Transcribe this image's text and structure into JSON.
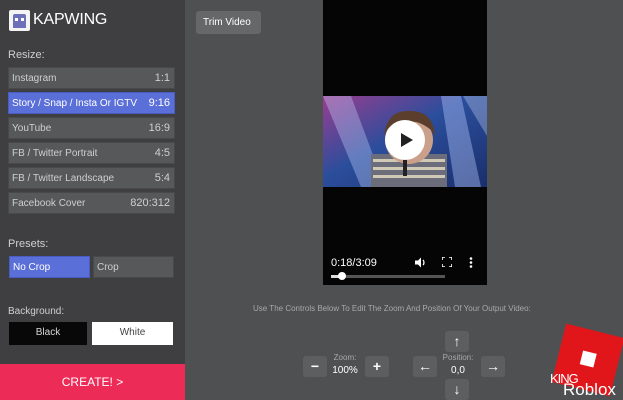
{
  "app": {
    "logo_text": "KAPWING"
  },
  "sidebar": {
    "resize_label": "Resize:",
    "sizes": [
      {
        "name": "Instagram",
        "ratio": "1:1"
      },
      {
        "name": "Story / Snap / Insta Or IGTV",
        "ratio": "9:16"
      },
      {
        "name": "YouTube",
        "ratio": "16:9"
      },
      {
        "name": "FB / Twitter Portrait",
        "ratio": "4:5"
      },
      {
        "name": "FB / Twitter Landscape",
        "ratio": "5:4"
      },
      {
        "name": "Facebook Cover",
        "ratio": "820:312"
      }
    ],
    "active_size_index": 1,
    "presets_label": "Presets:",
    "presets": [
      "No Crop",
      "Crop"
    ],
    "active_preset_index": 0,
    "background_label": "Background:",
    "backgrounds": [
      "Black",
      "White"
    ],
    "create_label": "CREATE! >"
  },
  "toolbar": {
    "trim_label": "Trim Video"
  },
  "player": {
    "time_display": "0:18/3:09",
    "progress_fraction": 0.095,
    "icons": [
      "play-icon",
      "volume-icon",
      "fullscreen-icon",
      "more-icon"
    ]
  },
  "controls": {
    "instructions": "Use The Controls Below To Edit The Zoom And Position Of Your Output Video:",
    "zoom_label": "Zoom:",
    "zoom_value": "100%",
    "position_label": "Position:",
    "position_value": "0,0",
    "icons": [
      "minus-icon",
      "plus-icon",
      "arrow-up-icon",
      "arrow-left-icon",
      "arrow-right-icon",
      "arrow-down-icon"
    ]
  },
  "watermark": {
    "line1": "KING",
    "line2": "Roblox",
    "color": "#e0161b"
  },
  "colors": {
    "accent": "#5b6fd8",
    "create": "#ec2b57"
  }
}
